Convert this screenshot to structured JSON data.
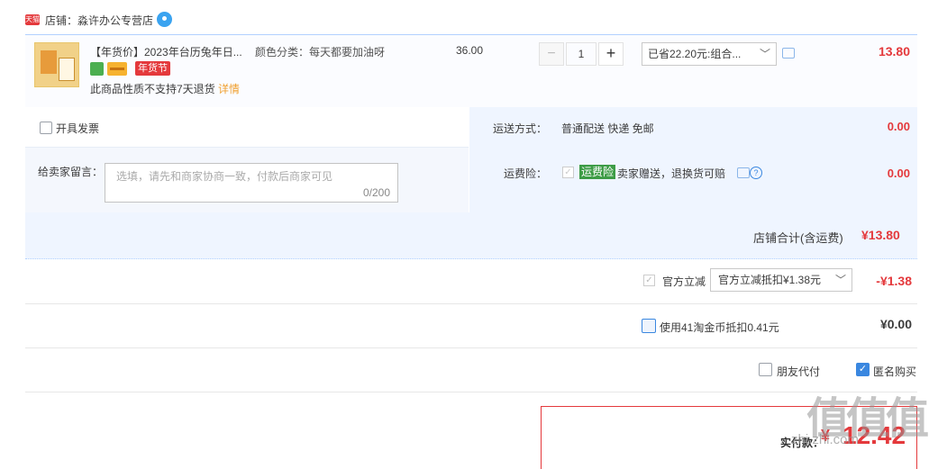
{
  "shop": {
    "badge": "天猫",
    "label": "店铺：淼许办公专营店"
  },
  "item": {
    "title": "【年货价】2023年台历兔年日...",
    "sku": "颜色分类：每天都要加油呀",
    "unit_price": "36.00",
    "festival_tag": "年货节",
    "no_return": "此商品性质不支持7天退货",
    "detail_link": "详情",
    "quantity": "1",
    "qty_minus": "−",
    "qty_plus": "+",
    "promo": "已省22.20元:组合...",
    "total": "13.80"
  },
  "invoice": {
    "label": "开具发票"
  },
  "message": {
    "label": "给卖家留言：",
    "placeholder": "选填，请先和商家协商一致，付款后商家可见",
    "counter": "0/200"
  },
  "shipping": {
    "label": "运送方式：",
    "method": "普通配送 快递 免邮",
    "price": "0.00"
  },
  "insurance": {
    "label": "运费险：",
    "tag": "运费险",
    "text": "卖家赠送，退换货可赔",
    "price": "0.00"
  },
  "shop_total": {
    "label": "店铺合计(含运费)",
    "value": "¥13.80"
  },
  "official_discount": {
    "label": "官方立减",
    "select": "官方立减抵扣¥1.38元",
    "amount": "-¥1.38"
  },
  "coins": {
    "label": "使用41淘金币抵扣0.41元",
    "amount": "¥0.00"
  },
  "friend_pay": {
    "label": "朋友代付"
  },
  "anonymous": {
    "label": "匿名购买",
    "checked": true
  },
  "pay": {
    "label": "实付款：",
    "yen": "¥",
    "amount": "12.42"
  },
  "watermark": {
    "text": "值值值",
    "sub": "zhi.zhi.com"
  },
  "colors": {
    "accent": "#e4393c",
    "link_blue": "#3a87e0",
    "panel": "#eff5ff"
  }
}
